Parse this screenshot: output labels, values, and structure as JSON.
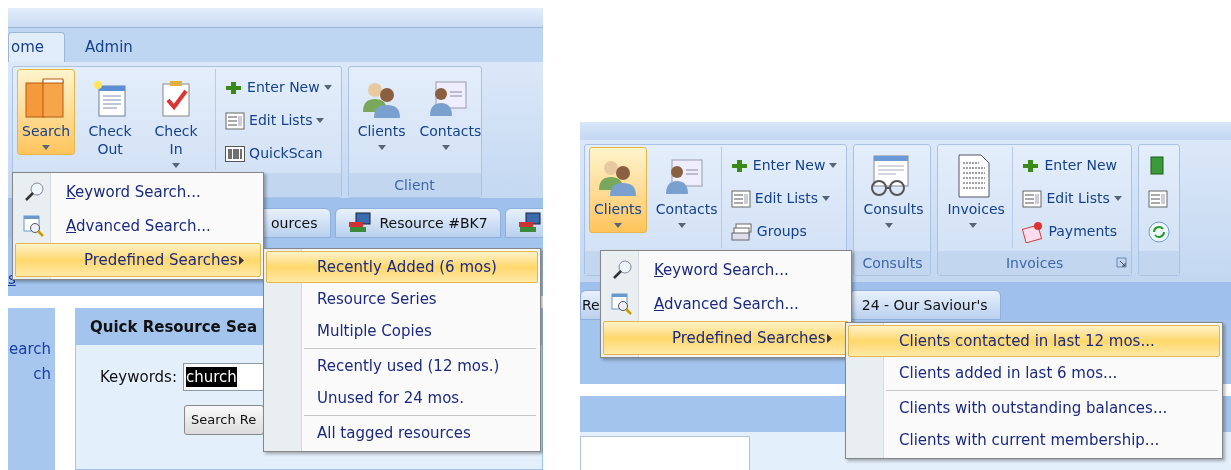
{
  "panels": [
    {
      "ribbon_tabs": [
        {
          "label": "ome",
          "selected": true
        },
        {
          "label": "Admin",
          "selected": false
        }
      ],
      "ribbon_groups": [
        {
          "buttons": [
            {
              "kind": "large",
              "label": "Search",
              "dropdown": true,
              "selected": true
            },
            {
              "kind": "large",
              "label": "Check Out",
              "dropdown": false,
              "selected": false
            },
            {
              "kind": "large",
              "label": "Check In",
              "dropdown": true,
              "selected": false
            },
            {
              "kind": "small",
              "label": "Enter New",
              "dropdown": true,
              "selected": false
            },
            {
              "kind": "small",
              "label": "Edit Lists",
              "dropdown": true,
              "selected": false
            },
            {
              "kind": "small",
              "label": "QuickScan",
              "dropdown": false,
              "selected": false
            }
          ]
        },
        {
          "label": "Client",
          "buttons": [
            {
              "kind": "large",
              "label": "Clients",
              "dropdown": true,
              "selected": false
            },
            {
              "kind": "large",
              "label": "Contacts",
              "dropdown": true,
              "selected": false
            }
          ]
        }
      ],
      "document_tabs": [
        {
          "label": "ources",
          "icon": false
        },
        {
          "label": "Resource #BK7",
          "icon": true
        },
        {
          "icon": true
        }
      ],
      "content_link": "s",
      "sidebar_items": [
        "earch",
        "ch"
      ],
      "quick_search": {
        "title": "Quick Resource Sea",
        "label": "Keywords:",
        "value": "church",
        "button": "Search Re"
      },
      "menu": [
        {
          "label": "Keyword Search...",
          "selected": false
        },
        {
          "label": "Advanced Search...",
          "selected": false
        },
        {
          "label": "Predefined Searches",
          "selected": true
        }
      ],
      "submenu": [
        {
          "label": "Recently Added (6 mos)",
          "selected": true,
          "separator_before": false
        },
        {
          "label": "Resource Series",
          "selected": false,
          "separator_before": false
        },
        {
          "label": "Multiple Copies",
          "selected": false,
          "separator_before": false
        },
        {
          "label": "Recently used (12 mos.)",
          "selected": false,
          "separator_before": true
        },
        {
          "label": "Unused for 24 mos.",
          "selected": false,
          "separator_before": false
        },
        {
          "label": "All tagged resources",
          "selected": false,
          "separator_before": true
        }
      ]
    },
    {
      "ribbon_groups": [
        {
          "buttons": [
            {
              "kind": "large",
              "label": "Clients",
              "dropdown": true,
              "selected": true
            },
            {
              "kind": "large",
              "label": "Contacts",
              "dropdown": true,
              "selected": false
            },
            {
              "kind": "small",
              "label": "Enter New",
              "dropdown": true,
              "selected": false
            },
            {
              "kind": "small",
              "label": "Edit Lists",
              "dropdown": true,
              "selected": false
            },
            {
              "kind": "small",
              "label": "Groups",
              "dropdown": false,
              "selected": false
            }
          ]
        },
        {
          "label": "Consults",
          "buttons": [
            {
              "kind": "large",
              "label": "Consults",
              "dropdown": true,
              "selected": false
            }
          ]
        },
        {
          "label": "Invoices",
          "launcher": true,
          "buttons": [
            {
              "kind": "large",
              "label": "Invoices",
              "dropdown": true,
              "selected": false
            },
            {
              "kind": "small",
              "label": "Enter New",
              "dropdown": false,
              "selected": false
            },
            {
              "kind": "small",
              "label": "Edit Lists",
              "dropdown": true,
              "selected": false
            },
            {
              "kind": "small",
              "label": "Payments",
              "dropdown": false,
              "selected": false
            }
          ]
        },
        {
          "buttons": [
            {
              "kind": "tiny",
              "dropdown": false,
              "selected": false
            },
            {
              "kind": "tiny",
              "dropdown": false,
              "selected": false
            },
            {
              "kind": "tiny",
              "dropdown": false,
              "selected": false
            }
          ]
        }
      ],
      "document_tabs": [
        {
          "label": "Re",
          "icon": false
        },
        {
          "label": "24 - Our Saviour's",
          "icon": false
        }
      ],
      "menu": [
        {
          "label": "Keyword Search...",
          "selected": false
        },
        {
          "label": "Advanced Search...",
          "selected": false
        },
        {
          "label": "Predefined Searches",
          "selected": true
        }
      ],
      "submenu": [
        {
          "label": "Clients contacted in last 12 mos...",
          "selected": true,
          "separator_before": false
        },
        {
          "label": "Clients added in last 6 mos...",
          "selected": false,
          "separator_before": false
        },
        {
          "label": "Clients with outstanding balances...",
          "selected": false,
          "separator_before": true
        },
        {
          "label": "Clients with current membership...",
          "selected": false,
          "separator_before": false
        }
      ]
    }
  ]
}
